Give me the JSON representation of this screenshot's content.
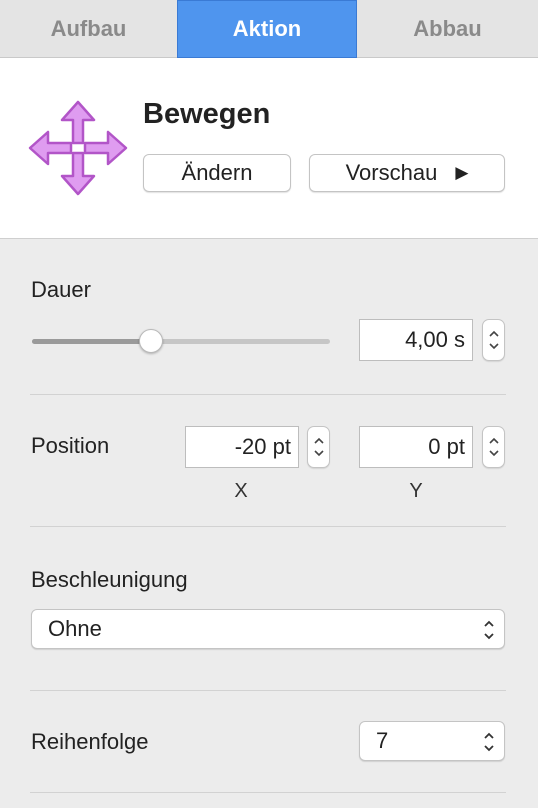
{
  "tabs": [
    {
      "label": "Aufbau",
      "active": false
    },
    {
      "label": "Aktion",
      "active": true
    },
    {
      "label": "Abbau",
      "active": false
    }
  ],
  "header": {
    "icon": "move-arrows-icon",
    "title": "Bewegen",
    "change_label": "Ändern",
    "preview_label": "Vorschau",
    "preview_icon": "play-icon"
  },
  "duration": {
    "label": "Dauer",
    "slider_fraction": 0.4,
    "value": "4,00 s"
  },
  "position": {
    "label": "Position",
    "x_value": "-20 pt",
    "y_value": "0 pt",
    "x_label": "X",
    "y_label": "Y"
  },
  "acceleration": {
    "label": "Beschleunigung",
    "value": "Ohne"
  },
  "order": {
    "label": "Reihenfolge",
    "value": "7"
  },
  "colors": {
    "accent": "#4f95ee",
    "icon": "#d77ee6"
  }
}
